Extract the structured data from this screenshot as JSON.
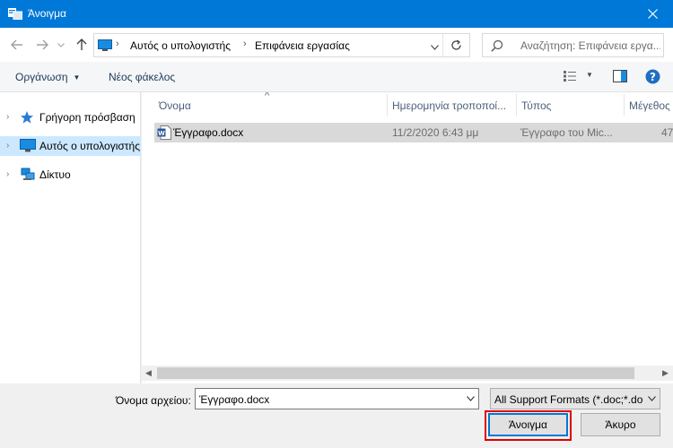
{
  "window": {
    "title": "Άνοιγμα"
  },
  "address": {
    "breadcrumbs": [
      "Αυτός ο υπολογιστής",
      "Επιφάνεια εργασίας"
    ],
    "search_placeholder": "Αναζήτηση: Επιφάνεια εργα..."
  },
  "toolbar": {
    "organize_label": "Οργάνωση",
    "new_folder_label": "Νέος φάκελος"
  },
  "nav": {
    "items": [
      {
        "label": "Γρήγορη πρόσβαση",
        "icon": "star-icon"
      },
      {
        "label": "Αυτός ο υπολογιστής",
        "icon": "computer-icon"
      },
      {
        "label": "Δίκτυο",
        "icon": "network-icon"
      }
    ]
  },
  "columns": {
    "name": "Όνομα",
    "date": "Ημερομηνία τροποποί...",
    "type": "Τύπος",
    "size": "Μέγεθος"
  },
  "files": [
    {
      "name": "Έγγραφο.docx",
      "date": "11/2/2020 6:43 μμ",
      "type": "Έγγραφο του Mic...",
      "size": "47",
      "icon": "word-doc-icon"
    }
  ],
  "footer": {
    "filename_label": "Όνομα αρχείου:",
    "filename_value": "Έγγραφο.docx",
    "filter_value": "All Support Formats (*.doc;*.do",
    "open_label": "Άνοιγμα",
    "cancel_label": "Άκυρο"
  },
  "colors": {
    "titlebar": "#0078d7",
    "selection": "#cce8ff",
    "highlight": "#e00000"
  }
}
